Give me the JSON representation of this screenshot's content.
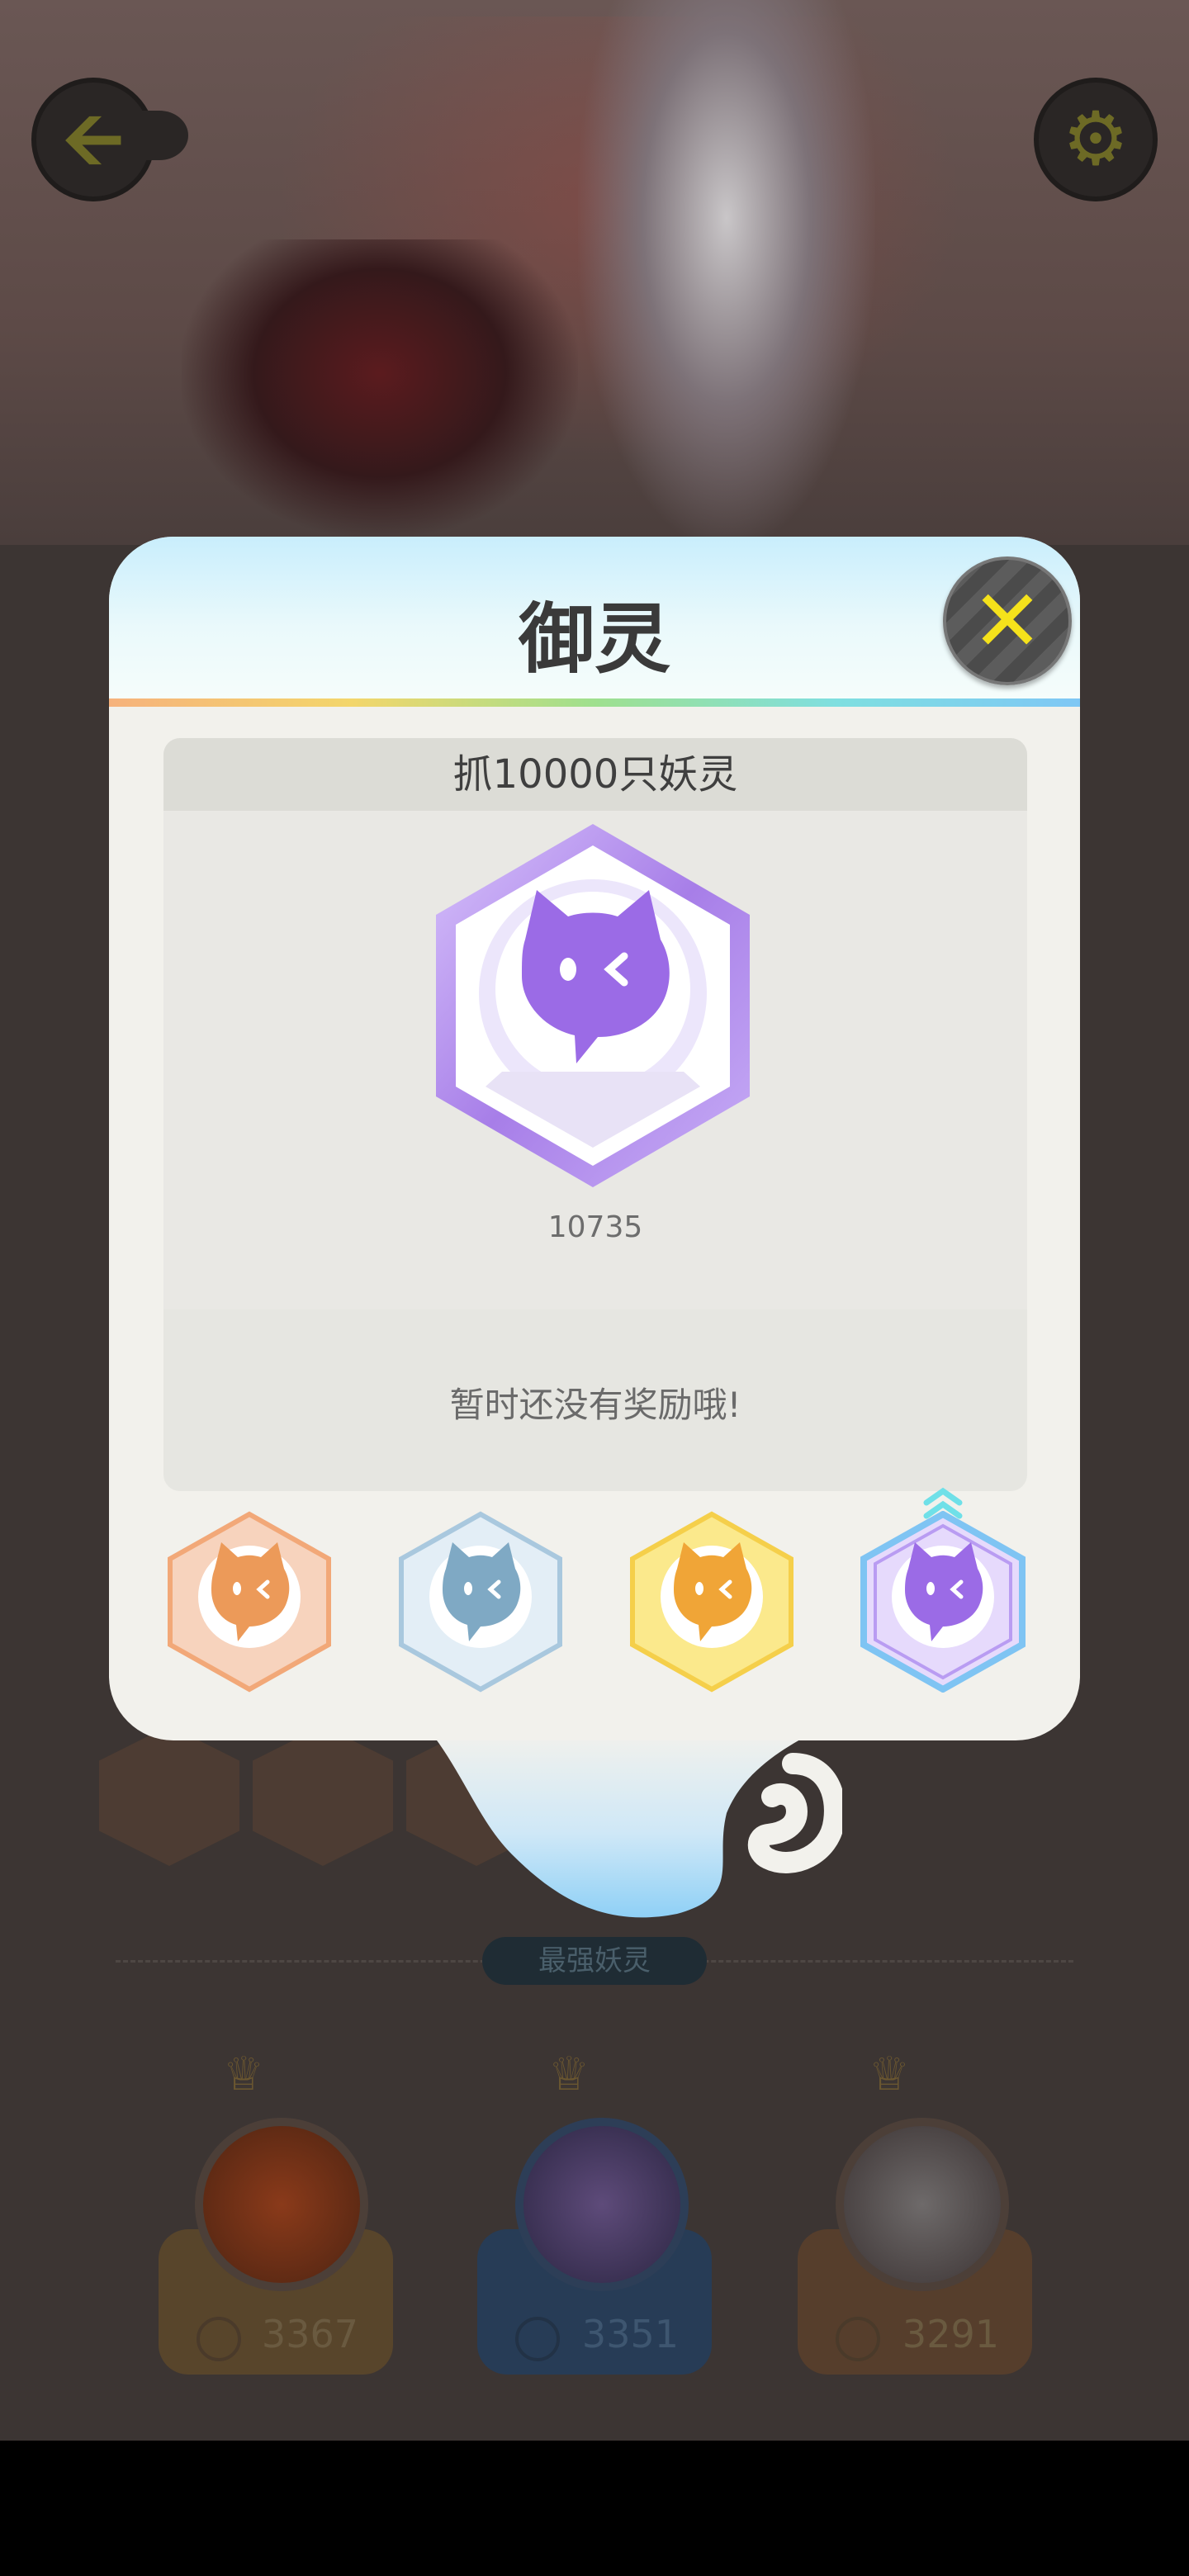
{
  "header": {
    "back_icon": "arrow-left-icon",
    "settings_icon": "gear-icon"
  },
  "dialog": {
    "title": "御灵",
    "close_icon": "close-x-icon",
    "achievement": {
      "title": "抓10000只妖灵",
      "count": "10735",
      "reward_text": "暂时还没有奖励哦!"
    },
    "tiers": [
      {
        "name": "bronze",
        "color": "#f2a878"
      },
      {
        "name": "silver",
        "color": "#a9c8de"
      },
      {
        "name": "gold",
        "color": "#f5cf4a"
      },
      {
        "name": "purple",
        "color": "#a77ee8",
        "selected": true
      }
    ]
  },
  "ranking": {
    "section_title": "最强妖灵",
    "entries": [
      {
        "score": "3367"
      },
      {
        "score": "3351"
      },
      {
        "score": "3291"
      }
    ]
  },
  "colors": {
    "accent_purple": "#9b6be6",
    "close_yellow": "#f5e21b"
  }
}
